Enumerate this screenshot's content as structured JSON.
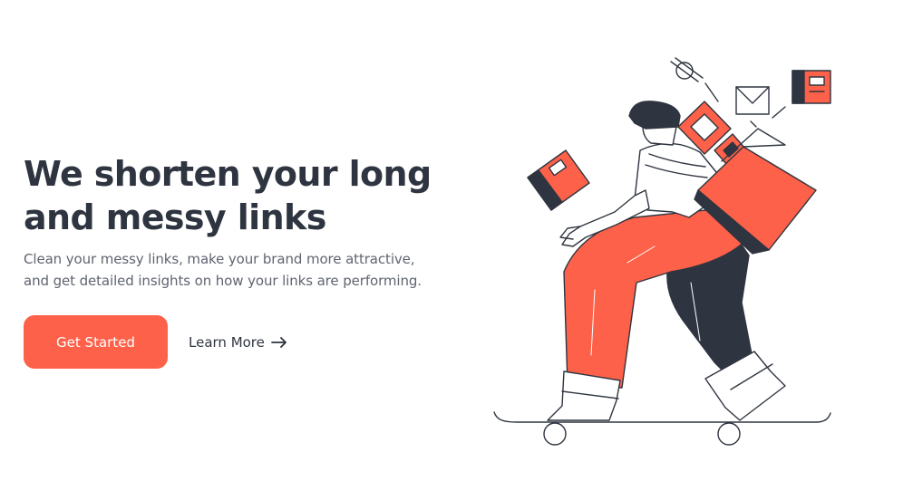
{
  "hero": {
    "headline_line1": "We shorten your long",
    "headline_line2": "and messy links",
    "subtext_line1": "Clean your messy links, make your brand more attractive,",
    "subtext_line2": "and get detailed insights on how your links are performing."
  },
  "actions": {
    "primary_label": "Get Started",
    "secondary_label": "Learn More"
  },
  "colors": {
    "accent": "#fe6149",
    "dark": "#2f3540",
    "text_muted": "#5f6470"
  },
  "icons": {
    "arrow": "arrow-right-icon",
    "illustration": "skateboarder-illustration"
  }
}
